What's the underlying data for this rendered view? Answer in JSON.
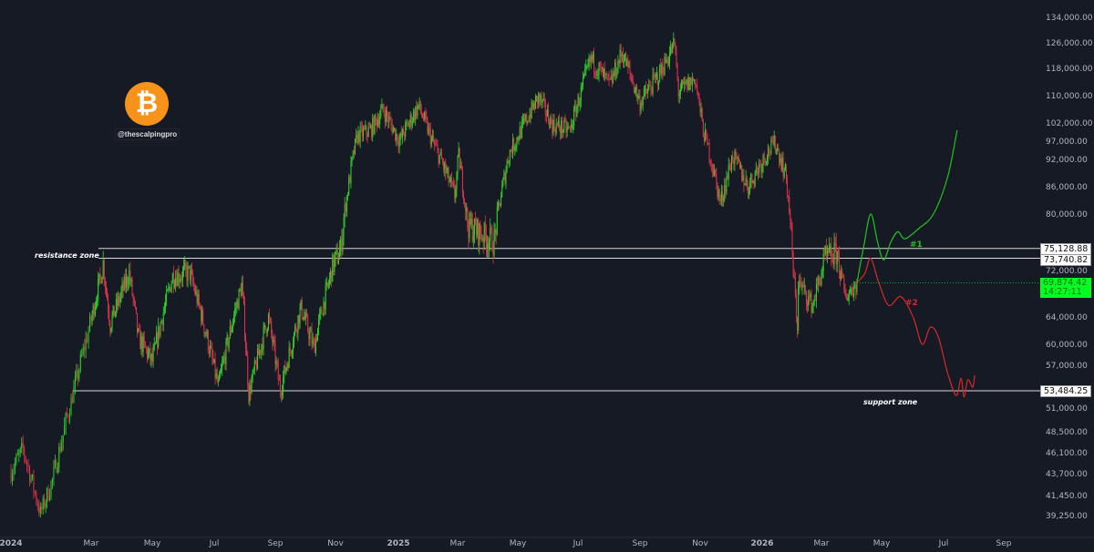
{
  "chart_data": {
    "type": "candlestick",
    "title": "",
    "y_scale": "price (non-linear axis)",
    "y_ticks": [
      "134,000.00",
      "126,000.00",
      "118,000.00",
      "110,000.00",
      "102,000.00",
      "97,000.00",
      "92,000.00",
      "86,000.00",
      "80,000.00",
      "72,000.00",
      "64,000.00",
      "60,000.00",
      "57,000.00",
      "54,000.00",
      "51,000.00",
      "48,500.00",
      "46,100.00",
      "43,700.00",
      "41,450.00",
      "39,250.00"
    ],
    "x_ticks": [
      {
        "label": "2024",
        "date": "2024-01-01",
        "bold": true
      },
      {
        "label": "Mar",
        "date": "2024-03-01"
      },
      {
        "label": "May",
        "date": "2024-05-01"
      },
      {
        "label": "Jul",
        "date": "2024-07-01"
      },
      {
        "label": "Sep",
        "date": "2024-09-01"
      },
      {
        "label": "Nov",
        "date": "2024-11-01"
      },
      {
        "label": "2025",
        "date": "2025-01-01",
        "bold": true
      },
      {
        "label": "Mar",
        "date": "2025-03-01"
      },
      {
        "label": "May",
        "date": "2025-05-01"
      },
      {
        "label": "Jul",
        "date": "2025-07-01"
      },
      {
        "label": "Sep",
        "date": "2025-09-01"
      },
      {
        "label": "Nov",
        "date": "2025-11-01"
      },
      {
        "label": "2026",
        "date": "2026-01-01",
        "bold": true
      },
      {
        "label": "Mar",
        "date": "2026-03-01"
      },
      {
        "label": "May",
        "date": "2026-05-01"
      },
      {
        "label": "Jul",
        "date": "2026-07-01"
      },
      {
        "label": "Sep",
        "date": "2026-09-01"
      }
    ],
    "price_path": [
      [
        "2024-01-01",
        44000
      ],
      [
        "2024-01-10",
        46500
      ],
      [
        "2024-01-23",
        39500
      ],
      [
        "2024-02-01",
        43000
      ],
      [
        "2024-02-15",
        52000
      ],
      [
        "2024-02-28",
        62000
      ],
      [
        "2024-03-13",
        73000
      ],
      [
        "2024-03-20",
        63000
      ],
      [
        "2024-04-08",
        71500
      ],
      [
        "2024-04-17",
        61000
      ],
      [
        "2024-05-01",
        57500
      ],
      [
        "2024-05-21",
        71000
      ],
      [
        "2024-06-07",
        71500
      ],
      [
        "2024-07-05",
        54000
      ],
      [
        "2024-07-29",
        69500
      ],
      [
        "2024-08-05",
        53000
      ],
      [
        "2024-08-25",
        64000
      ],
      [
        "2024-09-06",
        53500
      ],
      [
        "2024-09-27",
        65500
      ],
      [
        "2024-10-10",
        59500
      ],
      [
        "2024-10-29",
        72500
      ],
      [
        "2024-11-06",
        75000
      ],
      [
        "2024-11-22",
        98500
      ],
      [
        "2024-12-05",
        100000
      ],
      [
        "2024-12-17",
        106000
      ],
      [
        "2025-01-02",
        97000
      ],
      [
        "2025-01-21",
        107000
      ],
      [
        "2025-02-03",
        97500
      ],
      [
        "2025-02-26",
        84000
      ],
      [
        "2025-03-02",
        93000
      ],
      [
        "2025-03-11",
        78500
      ],
      [
        "2025-04-07",
        76000
      ],
      [
        "2025-04-22",
        93500
      ],
      [
        "2025-05-22",
        109500
      ],
      [
        "2025-06-05",
        101500
      ],
      [
        "2025-06-23",
        100000
      ],
      [
        "2025-07-14",
        121000
      ],
      [
        "2025-08-02",
        113000
      ],
      [
        "2025-08-14",
        123000
      ],
      [
        "2025-09-01",
        108000
      ],
      [
        "2025-09-20",
        116000
      ],
      [
        "2025-10-06",
        125500
      ],
      [
        "2025-10-10",
        111000
      ],
      [
        "2025-10-27",
        115000
      ],
      [
        "2025-11-04",
        100000
      ],
      [
        "2025-11-21",
        82500
      ],
      [
        "2025-12-03",
        93000
      ],
      [
        "2025-12-18",
        86000
      ],
      [
        "2026-01-05",
        93500
      ],
      [
        "2026-01-14",
        96500
      ],
      [
        "2026-01-25",
        88000
      ],
      [
        "2026-02-05",
        62500
      ],
      [
        "2026-02-06",
        70000
      ],
      [
        "2026-02-20",
        66000
      ],
      [
        "2026-03-04",
        73500
      ],
      [
        "2026-03-17",
        74500
      ],
      [
        "2026-03-25",
        67500
      ],
      [
        "2026-04-06",
        69874.42
      ]
    ],
    "projections": [
      {
        "name": "#1",
        "color": "#22c31e",
        "path": [
          [
            "2026-04-06",
            69874
          ],
          [
            "2026-04-13",
            75500
          ],
          [
            "2026-04-20",
            80000
          ],
          [
            "2026-04-27",
            76000
          ],
          [
            "2026-05-03",
            73500
          ],
          [
            "2026-05-10",
            76000
          ],
          [
            "2026-05-17",
            77500
          ],
          [
            "2026-05-24",
            76500
          ],
          [
            "2026-06-07",
            78000
          ],
          [
            "2026-06-21",
            80000
          ],
          [
            "2026-07-05",
            88000
          ],
          [
            "2026-07-15",
            100000
          ]
        ]
      },
      {
        "name": "#2",
        "color": "#d42a2a",
        "path": [
          [
            "2026-04-06",
            69874
          ],
          [
            "2026-04-14",
            71500
          ],
          [
            "2026-04-20",
            73740
          ],
          [
            "2026-04-28",
            70000
          ],
          [
            "2026-05-08",
            66000
          ],
          [
            "2026-05-20",
            67500
          ],
          [
            "2026-06-01",
            64000
          ],
          [
            "2026-06-10",
            60000
          ],
          [
            "2026-06-18",
            62500
          ],
          [
            "2026-06-26",
            61000
          ],
          [
            "2026-07-05",
            56000
          ],
          [
            "2026-07-14",
            52800
          ],
          [
            "2026-07-19",
            55200
          ],
          [
            "2026-07-22",
            52600
          ],
          [
            "2026-07-26",
            55000
          ],
          [
            "2026-07-31",
            54000
          ],
          [
            "2026-08-02",
            55600
          ]
        ]
      }
    ],
    "levels": [
      {
        "name": "resistance zone",
        "values": [
          75128.88,
          73740.82
        ],
        "labels": [
          "75,128.88",
          "73,740.82"
        ]
      },
      {
        "name": "support zone",
        "values": [
          53484.25
        ],
        "labels": [
          "53,484.25"
        ]
      }
    ],
    "current_price": "69,874.42",
    "countdown": "14:27:11",
    "colors": {
      "background": "#161a25",
      "up": "#2ed52a",
      "down": "#e0344c",
      "current": "#00ff22"
    }
  },
  "watermark": {
    "handle": "@thescalpingpro",
    "logo": "bitcoin-logo"
  }
}
